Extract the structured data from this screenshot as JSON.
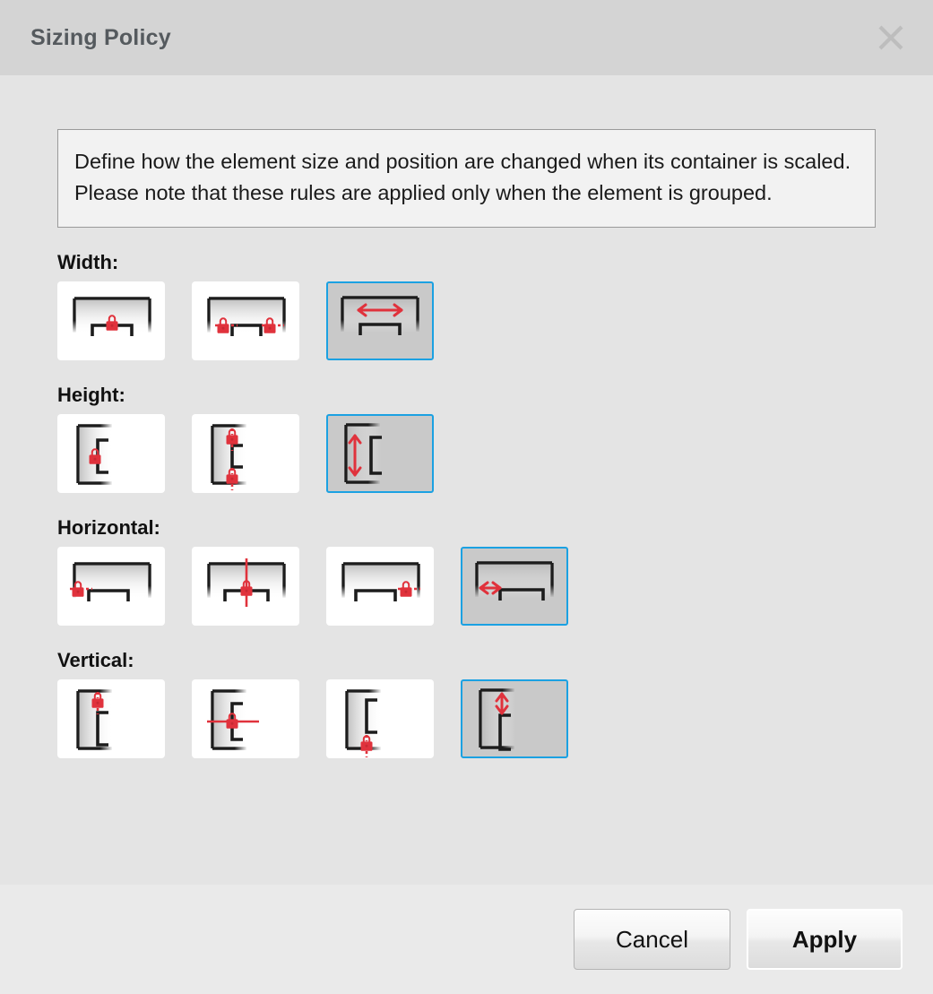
{
  "dialog": {
    "title": "Sizing Policy",
    "close_icon": "close-icon",
    "description": "Define how the element size and position are changed when its container is scaled. Please note that these rules are applied only when the element is grouped.",
    "accent_color": "#1ba1e2",
    "lock_color": "#e0323c",
    "titlebar_color": "#d4d4d4",
    "body_color": "#e4e4e4",
    "footer_color": "#eaeaea"
  },
  "groups": [
    {
      "label": "Width:",
      "name": "width",
      "selected_index": 2,
      "options": [
        {
          "name": "width-fixed-center-lock",
          "icon": "lock-center-horizontal-icon"
        },
        {
          "name": "width-fixed-both-locks",
          "icon": "lock-both-sides-horizontal-icon"
        },
        {
          "name": "width-scale",
          "icon": "resize-horizontal-arrow-icon"
        }
      ]
    },
    {
      "label": "Height:",
      "name": "height",
      "selected_index": 2,
      "options": [
        {
          "name": "height-fixed-center-lock",
          "icon": "lock-center-vertical-icon"
        },
        {
          "name": "height-fixed-both-locks",
          "icon": "lock-both-sides-vertical-icon"
        },
        {
          "name": "height-scale",
          "icon": "resize-vertical-arrow-icon"
        }
      ]
    },
    {
      "label": "Horizontal:",
      "name": "horizontal",
      "selected_index": 3,
      "options": [
        {
          "name": "horizontal-anchor-left",
          "icon": "lock-left-icon"
        },
        {
          "name": "horizontal-anchor-center",
          "icon": "lock-center-crosshair-vertical-icon"
        },
        {
          "name": "horizontal-anchor-right",
          "icon": "lock-right-icon"
        },
        {
          "name": "horizontal-scale",
          "icon": "offset-horizontal-arrow-icon"
        }
      ]
    },
    {
      "label": "Vertical:",
      "name": "vertical",
      "selected_index": 3,
      "options": [
        {
          "name": "vertical-anchor-top",
          "icon": "lock-top-icon"
        },
        {
          "name": "vertical-anchor-middle",
          "icon": "lock-center-crosshair-horizontal-icon"
        },
        {
          "name": "vertical-anchor-bottom",
          "icon": "lock-bottom-icon"
        },
        {
          "name": "vertical-scale",
          "icon": "offset-vertical-arrow-icon"
        }
      ]
    }
  ],
  "footer": {
    "cancel_label": "Cancel",
    "apply_label": "Apply"
  }
}
